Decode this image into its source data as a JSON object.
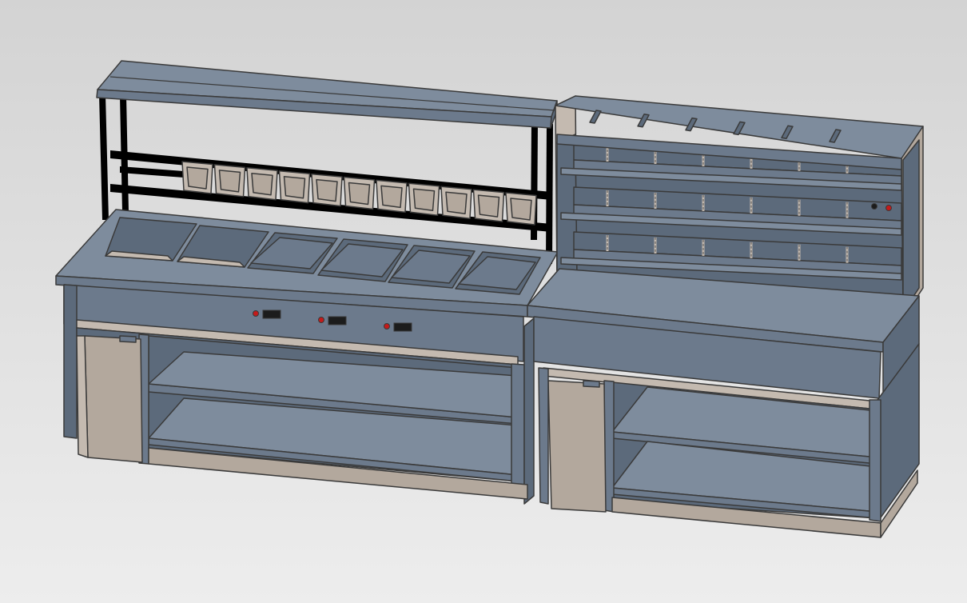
{
  "scene": {
    "colors": {
      "background_top": "#d3d3d3",
      "background_bottom": "#ededed",
      "steel": "#6c7a8c",
      "steel_light": "#7e8c9d",
      "steel_dark": "#5c6a7b",
      "beige": "#b3a89d",
      "beige_light": "#c4bab0",
      "outline": "#3a3a3a",
      "indicator_red": "#c41a1a",
      "switch_black": "#1c1c1c"
    },
    "components": {
      "left_unit": {
        "top_shelf": true,
        "small_pans": 11,
        "wells": 6,
        "controls": 3,
        "undershelves": 2
      },
      "right_unit": {
        "top_slots": 6,
        "heated_shelves": 3,
        "lamps_per_shelf": 6,
        "controls": 2,
        "undershelves": 2
      }
    }
  }
}
